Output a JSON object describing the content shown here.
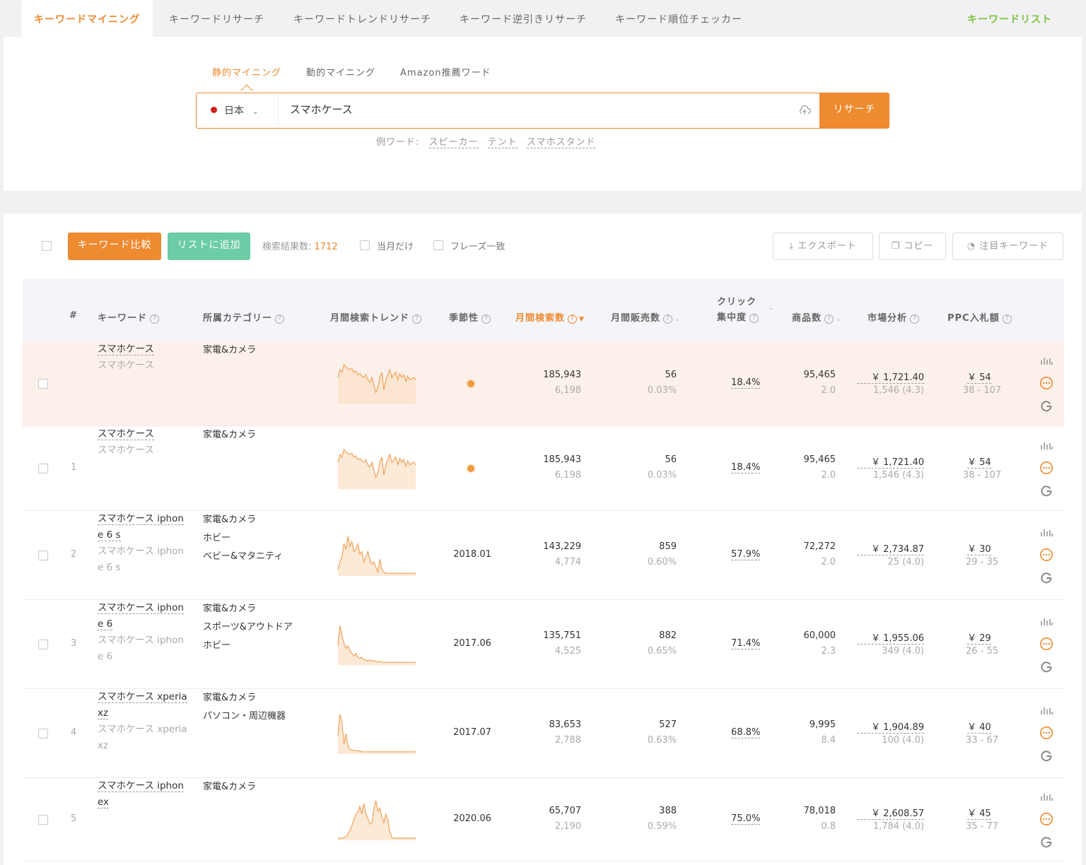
{
  "nav": {
    "tabs": [
      "キーワードマイニング",
      "キーワードリサーチ",
      "キーワードトレンドリサーチ",
      "キーワード逆引きリサーチ",
      "キーワード順位チェッカー"
    ],
    "right_link": "キーワードリスト"
  },
  "search": {
    "modes": [
      "静的マイニング",
      "動的マイニング",
      "Amazon推薦ワード"
    ],
    "country": "日本",
    "query": "スマホケース",
    "button": "リサーチ",
    "examples_label": "例ワード:",
    "examples": [
      "スピーカー",
      "テント",
      "スマホスタンド"
    ]
  },
  "toolbar": {
    "compare_button": "キーワード比較",
    "add_list_button": "リストに追加",
    "result_label": "検索結果数:",
    "result_count": "1712",
    "filter_month": "当月だけ",
    "filter_phrase": "フレーズ一致",
    "export_button": "エクスポート",
    "copy_button": "コピー",
    "watch_button": "注目キーワード"
  },
  "columns": {
    "index": "#",
    "keyword": "キーワード",
    "category": "所属カテゴリー",
    "trend": "月間検索トレンド",
    "season": "季節性",
    "search_volume": "月間検索数",
    "sales": "月間販売数",
    "click_line1": "クリック",
    "click_line2": "集中度",
    "products": "商品数",
    "market": "市場分析",
    "ppc": "PPC入札額"
  },
  "rows": [
    {
      "index": "",
      "kw": "スマホケース",
      "kw_alt": "スマホケース",
      "cats": [
        "家電&カメラ"
      ],
      "season": "dot",
      "vol": "185,943",
      "vol_sub": "6,198",
      "sales": "56",
      "sales_sub": "0.03%",
      "click": "18.4%",
      "prod": "95,465",
      "prod_sub": "2.0",
      "market": "￥ 1,721.40",
      "market_sub": "1,546 (4.3)",
      "ppc": "￥ 54",
      "ppc_sub": "38 - 107",
      "trend": [
        20,
        26,
        24,
        30,
        28,
        27,
        26,
        27,
        24,
        25,
        22,
        23,
        21,
        20,
        22,
        18,
        16,
        20,
        14,
        8,
        12,
        20,
        24,
        10,
        18,
        22,
        26,
        20,
        22,
        24,
        18,
        23,
        20,
        22,
        17,
        21,
        18,
        19,
        20,
        18
      ]
    },
    {
      "index": "1",
      "kw": "スマホケース",
      "kw_alt": "スマホケース",
      "cats": [
        "家電&カメラ"
      ],
      "season": "dot",
      "vol": "185,943",
      "vol_sub": "6,198",
      "sales": "56",
      "sales_sub": "0.03%",
      "click": "18.4%",
      "prod": "95,465",
      "prod_sub": "2.0",
      "market": "￥ 1,721.40",
      "market_sub": "1,546 (4.3)",
      "ppc": "￥ 54",
      "ppc_sub": "38 - 107",
      "trend": [
        20,
        26,
        24,
        30,
        28,
        27,
        26,
        27,
        24,
        25,
        22,
        23,
        21,
        20,
        22,
        18,
        16,
        20,
        14,
        8,
        12,
        20,
        24,
        10,
        18,
        22,
        26,
        20,
        22,
        24,
        18,
        23,
        20,
        22,
        17,
        21,
        18,
        19,
        20,
        18
      ]
    },
    {
      "index": "2",
      "kw": "スマホケース iphone 6 s",
      "kw_alt": "スマホケース iphone 6 s",
      "cats": [
        "家電&カメラ",
        "ホビー",
        "ベビー&マタニティ"
      ],
      "season": "2018.01",
      "vol": "143,229",
      "vol_sub": "4,774",
      "sales": "859",
      "sales_sub": "0.60%",
      "click": "57.9%",
      "prod": "72,272",
      "prod_sub": "2.0",
      "market": "￥ 2,734.87",
      "market_sub": "25 (4.0)",
      "ppc": "￥ 30",
      "ppc_sub": "29 - 35",
      "trend": [
        4,
        10,
        14,
        24,
        20,
        30,
        22,
        26,
        18,
        20,
        24,
        16,
        18,
        10,
        14,
        18,
        12,
        8,
        10,
        6,
        2,
        12,
        4,
        2,
        1,
        1,
        1,
        1,
        1,
        1,
        1,
        1,
        1,
        1,
        1,
        1,
        1,
        1,
        1,
        1
      ]
    },
    {
      "index": "3",
      "kw": "スマホケース iphone 6",
      "kw_alt": "スマホケース iphone 6",
      "cats": [
        "家電&カメラ",
        "スポーツ&アウトドア",
        "ホビー"
      ],
      "season": "2017.06",
      "vol": "135,751",
      "vol_sub": "4,525",
      "sales": "882",
      "sales_sub": "0.65%",
      "click": "71.4%",
      "prod": "60,000",
      "prod_sub": "2.3",
      "market": "￥ 1,955.06",
      "market_sub": "349 (4.0)",
      "ppc": "￥ 29",
      "ppc_sub": "26 - 55",
      "trend": [
        14,
        30,
        22,
        16,
        12,
        14,
        10,
        8,
        6,
        8,
        5,
        4,
        5,
        3,
        3,
        2,
        3,
        2,
        2,
        2,
        1,
        2,
        1,
        1,
        1,
        1,
        1,
        1,
        1,
        1,
        1,
        1,
        1,
        1,
        1,
        1,
        1,
        1,
        1,
        1
      ]
    },
    {
      "index": "4",
      "kw": "スマホケース xperia xz",
      "kw_alt": "スマホケース xperia xz",
      "cats": [
        "家電&カメラ",
        "パソコン・周辺機器"
      ],
      "season": "2017.07",
      "vol": "83,653",
      "vol_sub": "2,788",
      "sales": "527",
      "sales_sub": "0.63%",
      "click": "68.8%",
      "prod": "9,995",
      "prod_sub": "8.4",
      "market": "￥ 1,904.89",
      "market_sub": "100 (4.0)",
      "ppc": "￥ 40",
      "ppc_sub": "33 - 67",
      "trend": [
        20,
        44,
        34,
        10,
        22,
        8,
        4,
        3,
        3,
        2,
        2,
        2,
        1,
        1,
        1,
        1,
        1,
        1,
        1,
        1,
        1,
        1,
        1,
        1,
        1,
        1,
        1,
        1,
        1,
        1,
        1,
        1,
        1,
        1,
        1,
        1,
        1,
        1,
        1,
        1
      ]
    },
    {
      "index": "5",
      "kw": "スマホケース iphonex",
      "kw_alt": "",
      "cats": [
        "家電&カメラ"
      ],
      "season": "2020.06",
      "vol": "65,707",
      "vol_sub": "2,190",
      "sales": "388",
      "sales_sub": "0.59%",
      "click": "75.0%",
      "prod": "78,018",
      "prod_sub": "0.8",
      "market": "￥ 2,608.57",
      "market_sub": "1,784 (4.0)",
      "ppc": "￥ 45",
      "ppc_sub": "35 - 77",
      "trend": [
        0,
        1,
        1,
        2,
        3,
        6,
        12,
        18,
        26,
        34,
        36,
        44,
        34,
        48,
        34,
        28,
        20,
        22,
        40,
        52,
        38,
        42,
        30,
        22,
        34,
        26,
        10,
        2,
        1,
        1,
        1,
        1,
        1,
        1,
        1,
        1,
        1,
        1,
        1,
        1
      ]
    }
  ]
}
